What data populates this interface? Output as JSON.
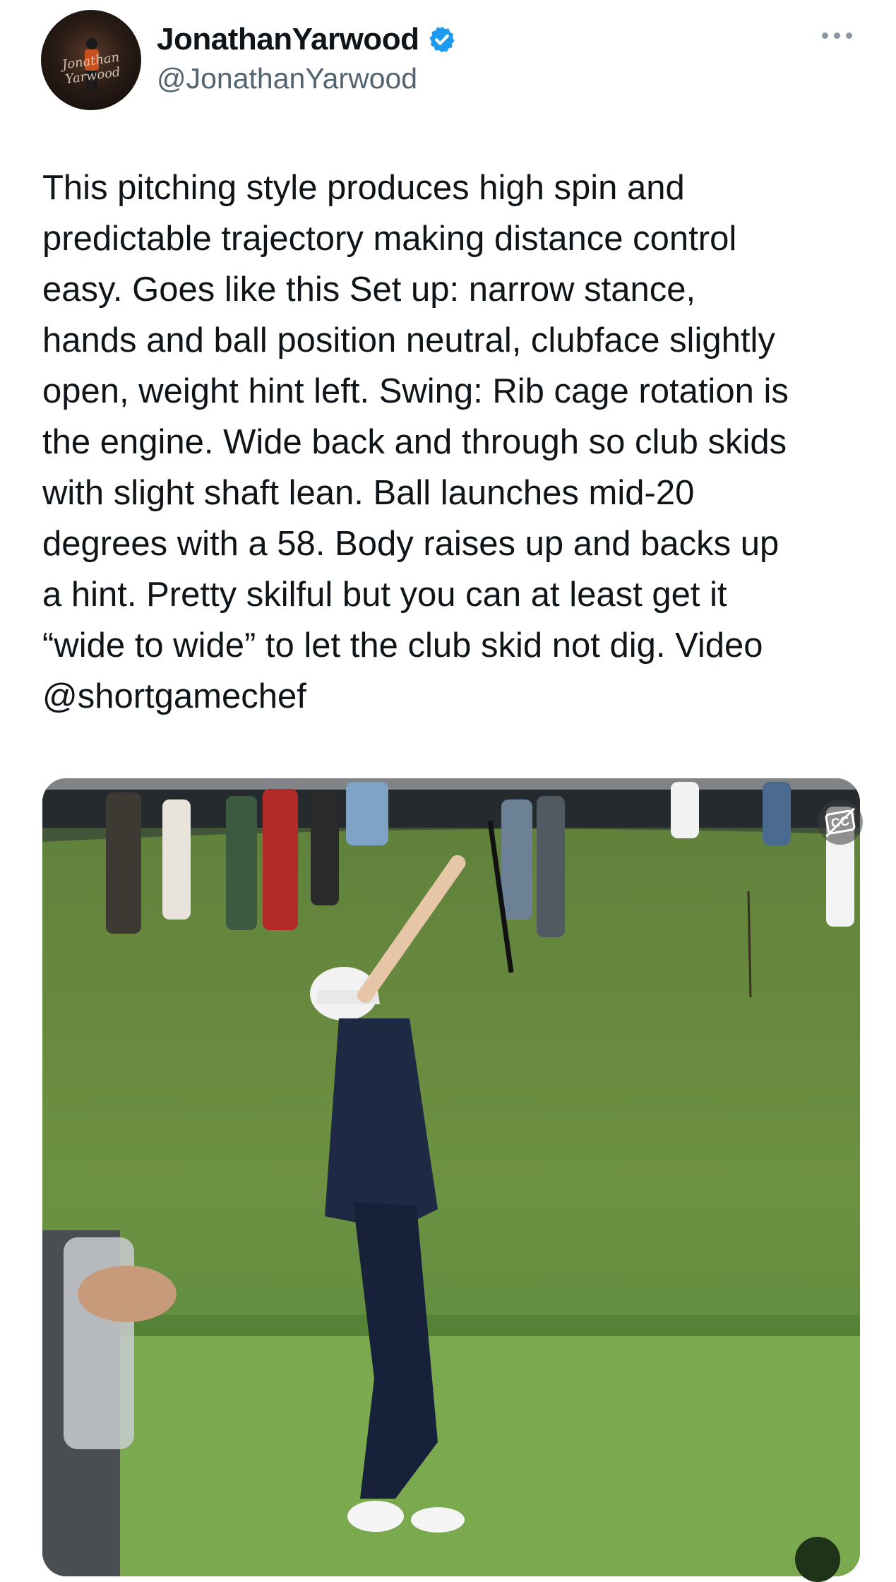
{
  "author": {
    "display_name": "JonathanYarwood",
    "handle": "@JonathanYarwood",
    "verified": true,
    "avatar_signature": "Jonathan Yarwood"
  },
  "tweet": {
    "text": "This pitching style produces high spin and\npredictable trajectory making distance control\neasy. Goes like this Set up: narrow stance,\nhands and ball position neutral, clubface slightly\nopen, weight hint left. Swing: Rib cage rotation is\nthe engine. Wide back and through so club skids\nwith slight shaft lean. Ball launches mid-20\ndegrees with a 58. Body raises up and backs up\na hint. Pretty skilful but you can at least get it\n“wide to wide” to let the club skid not dig. Video\n@shortgamechef"
  },
  "media": {
    "captions_label": "CC"
  },
  "icons": {
    "verified": "verified-badge-icon",
    "more": "more-options-icon",
    "captions": "captions-off-icon",
    "unmute": "unmute-icon"
  },
  "colors": {
    "text": "#0f1419",
    "secondary_text": "#536471",
    "verified_blue": "#1d9bf0",
    "background": "#ffffff"
  }
}
